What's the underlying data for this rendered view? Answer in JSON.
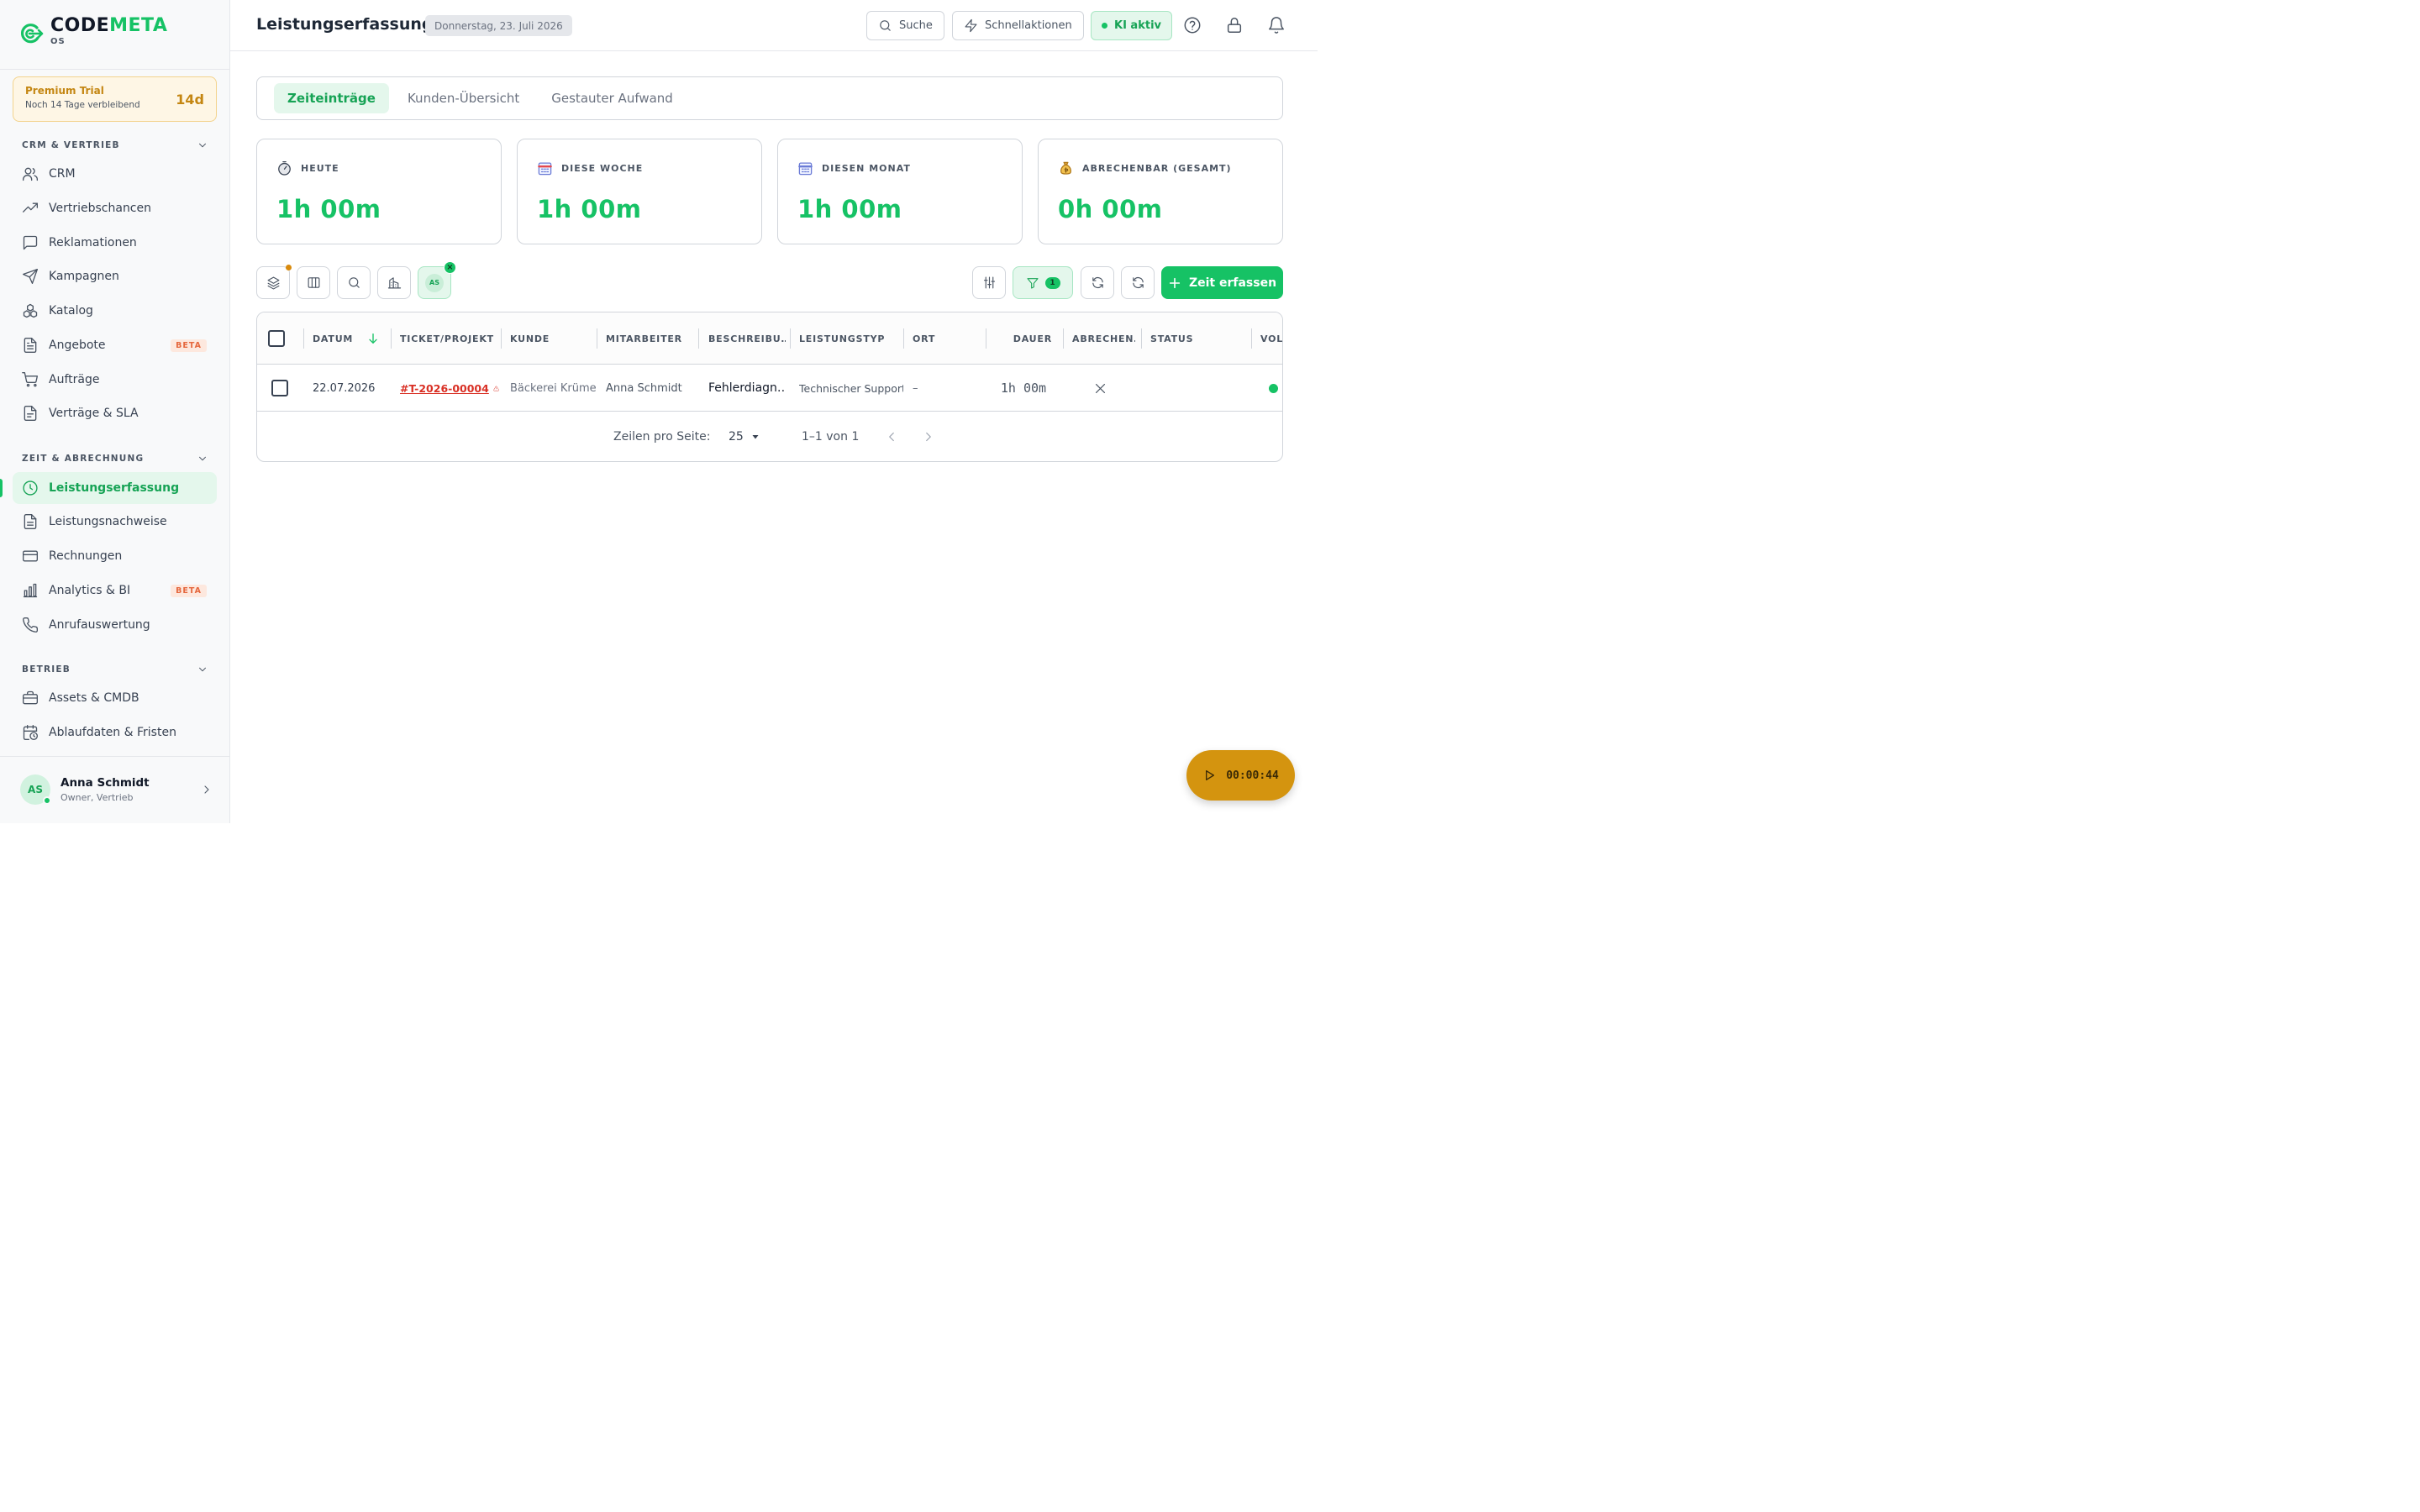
{
  "brand": {
    "name_part1": "CODE",
    "name_part2": "META",
    "sub": "OS",
    "accent": "#16c265"
  },
  "trial": {
    "title": "Premium Trial",
    "subtitle": "Noch 14 Tage verbleibend",
    "days": "14d"
  },
  "sidebar": {
    "sections": [
      {
        "title": "CRM & VERTRIEB"
      },
      {
        "title": "ZEIT & ABRECHNUNG"
      },
      {
        "title": "BETRIEB"
      }
    ],
    "items": [
      {
        "label": "CRM",
        "icon": "users-icon"
      },
      {
        "label": "Vertriebschancen",
        "icon": "trending-up-icon"
      },
      {
        "label": "Reklamationen",
        "icon": "message-square-icon"
      },
      {
        "label": "Kampagnen",
        "icon": "send-icon"
      },
      {
        "label": "Katalog",
        "icon": "boxes-icon"
      },
      {
        "label": "Angebote",
        "icon": "file-text-icon",
        "badge": "BETA"
      },
      {
        "label": "Aufträge",
        "icon": "cart-icon"
      },
      {
        "label": "Verträge & SLA",
        "icon": "file-contract-icon"
      },
      {
        "label": "Leistungserfassung",
        "icon": "clock-icon",
        "active": true
      },
      {
        "label": "Leistungsnachweise",
        "icon": "file-check-icon"
      },
      {
        "label": "Rechnungen",
        "icon": "credit-card-icon"
      },
      {
        "label": "Analytics & BI",
        "icon": "bar-chart-icon",
        "badge": "BETA"
      },
      {
        "label": "Anrufauswertung",
        "icon": "phone-icon"
      },
      {
        "label": "Assets & CMDB",
        "icon": "briefcase-icon"
      },
      {
        "label": "Ablaufdaten & Fristen",
        "icon": "calendar-clock-icon"
      }
    ]
  },
  "user": {
    "initials": "AS",
    "name": "Anna Schmidt",
    "role": "Owner, Vertrieb"
  },
  "header": {
    "title": "Leistungserfassung",
    "date": "Donnerstag, 23. Juli 2026",
    "search_label": "Suche",
    "quick_actions_label": "Schnellaktionen",
    "ai_label": "KI aktiv"
  },
  "tabs": [
    {
      "label": "Zeiteinträge",
      "active": true
    },
    {
      "label": "Kunden-Übersicht"
    },
    {
      "label": "Gestauter Aufwand"
    }
  ],
  "kpis": [
    {
      "label": "HEUTE",
      "value": "1h 00m",
      "icon": "stopwatch-icon"
    },
    {
      "label": "DIESE WOCHE",
      "value": "1h 00m",
      "icon": "calendar-icon"
    },
    {
      "label": "DIESEN MONAT",
      "value": "1h 00m",
      "icon": "calendar-icon"
    },
    {
      "label": "ABRECHENBAR (GESAMT)",
      "value": "0h 00m",
      "icon": "money-bag-icon"
    }
  ],
  "toolbar": {
    "user_filter_initials": "AS",
    "filter_count": "1",
    "add_label": "Zeit erfassen"
  },
  "table": {
    "columns": [
      "DATUM",
      "TICKET/PROJEKT",
      "KUNDE",
      "MITARBEITER",
      "BESCHREIBU…",
      "LEISTUNGSTYP",
      "ORT",
      "DAUER",
      "ABRECHEN…",
      "STATUS",
      "VOL…"
    ],
    "rows": [
      {
        "date": "22.07.2026",
        "ticket": "#T-2026-00004",
        "customer": "Bäckerei Krümel GmbH",
        "employee": "Anna Schmidt",
        "description": "Fehlerdiagn…",
        "service_type": "Technischer Support",
        "location": "–",
        "duration": "1h 00m",
        "billable": "no",
        "status": "",
        "volume_status_color": "#16c265"
      }
    ]
  },
  "pagination": {
    "rows_per_page_label": "Zeilen pro Seite:",
    "rows_per_page": "25",
    "range": "1–1 von 1"
  },
  "timer": {
    "elapsed": "00:00:44"
  }
}
